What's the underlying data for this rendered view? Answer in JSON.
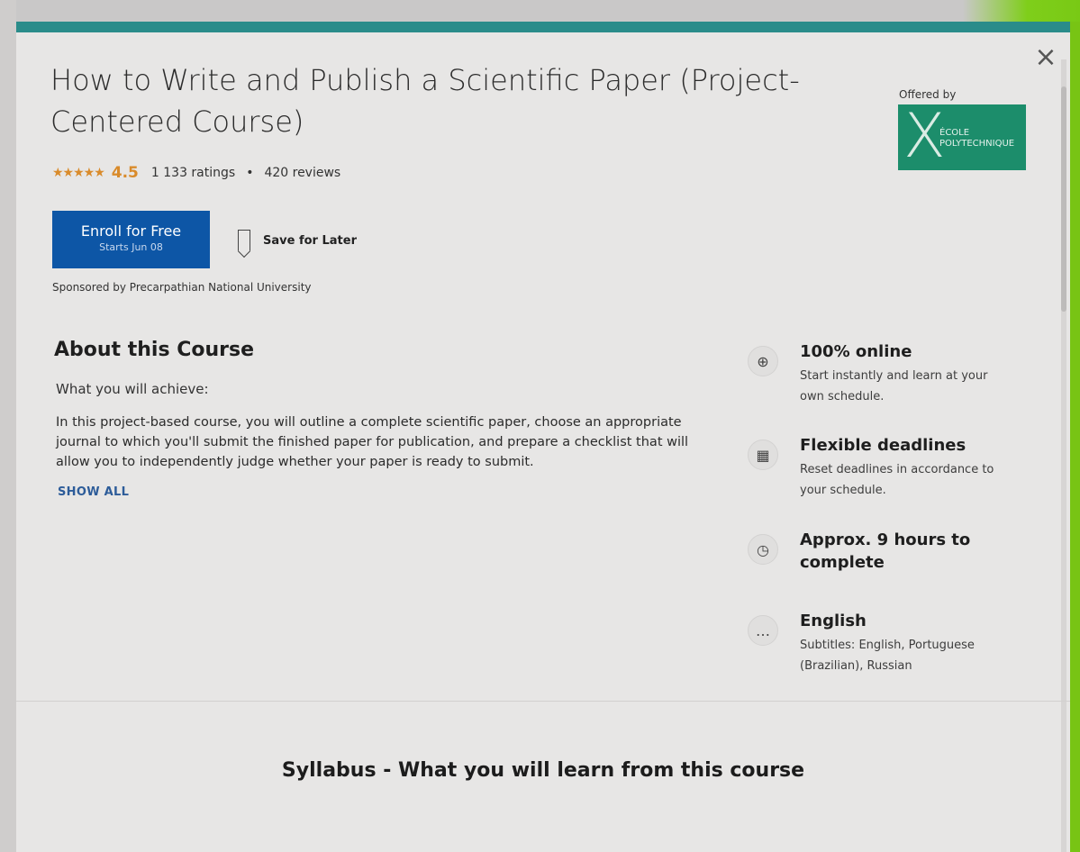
{
  "course": {
    "title": "How to Write and Publish a Scientific Paper (Project-Centered Course)",
    "stars": "★★★★★",
    "rating": "4.5",
    "ratings_count": "1 133 ratings",
    "separator": "•",
    "reviews_count": "420 reviews"
  },
  "actions": {
    "enroll_label": "Enroll for Free",
    "enroll_sub": "Starts Jun 08",
    "save_label": "Save for Later",
    "close_glyph": "×"
  },
  "sponsored": "Sponsored by Precarpathian National University",
  "offered": {
    "label": "Offered by",
    "logo_mark": "X",
    "logo_line1": "ÉCOLE",
    "logo_line2": "POLYTECHNIQUE",
    "logo_color": "#1c8d6b"
  },
  "about": {
    "title": "About this Course",
    "subtitle": "What you will achieve:",
    "description": "In this project-based course, you will outline a complete scientific paper, choose an appropriate journal to which you'll submit the finished paper for publication, and prepare a checklist that will allow you to independently judge whether your paper is ready to submit.",
    "show_all": "SHOW ALL"
  },
  "features": [
    {
      "icon": "globe-icon",
      "glyph": "⊕",
      "title": "100% online",
      "desc": "Start instantly and learn at your own schedule."
    },
    {
      "icon": "calendar-icon",
      "glyph": "▦",
      "title": "Flexible deadlines",
      "desc": "Reset deadlines in accordance to your schedule."
    },
    {
      "icon": "clock-icon",
      "glyph": "◷",
      "title": "Approx. 9 hours to complete",
      "desc": ""
    },
    {
      "icon": "chat-icon",
      "glyph": "…",
      "title": "English",
      "desc": "Subtitles: English, Portuguese (Brazilian), Russian"
    }
  ],
  "syllabus_title": "Syllabus - What you will learn from this course",
  "colors": {
    "accent_bar": "#2a8c8a",
    "enroll_button": "#0d56a6",
    "rating": "#d98b2b",
    "link": "#2d5c99"
  }
}
